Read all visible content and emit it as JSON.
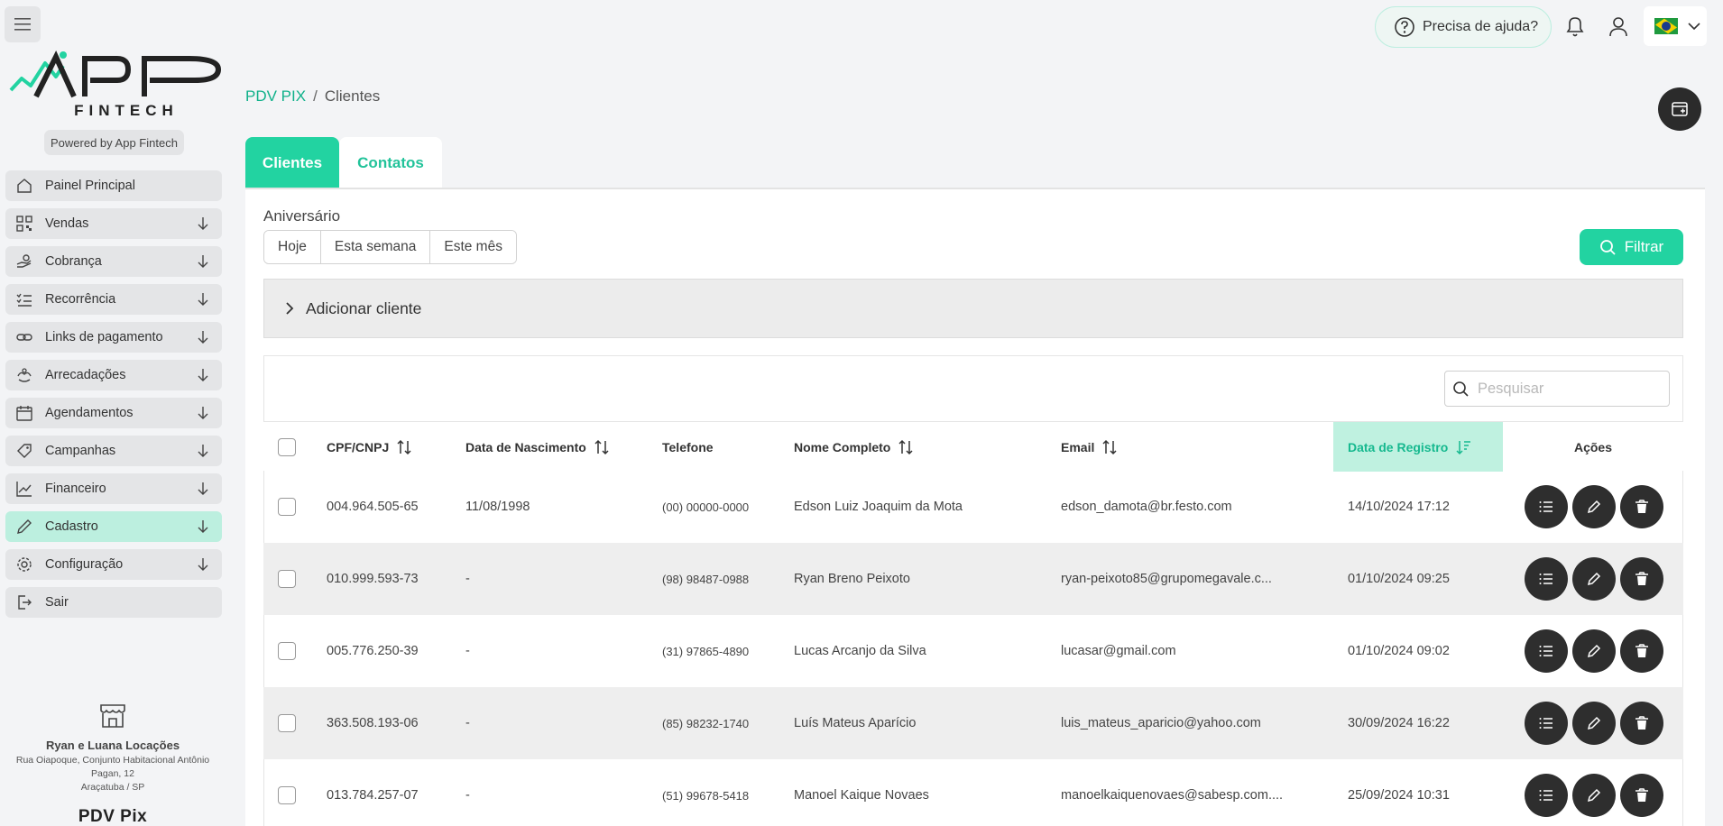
{
  "sidebar": {
    "logo_text": "APP",
    "logo_sub": "FINTECH",
    "powered_by": "Powered by App Fintech",
    "items": [
      {
        "label": "Painel Principal",
        "icon": "home-icon"
      },
      {
        "label": "Vendas",
        "icon": "qrcode-icon"
      },
      {
        "label": "Cobrança",
        "icon": "hand-coin-icon"
      },
      {
        "label": "Recorrência",
        "icon": "list-check-icon"
      },
      {
        "label": "Links de pagamento",
        "icon": "link-icon"
      },
      {
        "label": "Arrecadações",
        "icon": "hands-icon"
      },
      {
        "label": "Agendamentos",
        "icon": "calendar-icon"
      },
      {
        "label": "Campanhas",
        "icon": "tag-icon"
      },
      {
        "label": "Financeiro",
        "icon": "chart-line-icon"
      },
      {
        "label": "Cadastro",
        "icon": "pencil-icon"
      },
      {
        "label": "Configuração",
        "icon": "gear-icon"
      },
      {
        "label": "Sair",
        "icon": "logout-icon"
      }
    ],
    "store": {
      "name": "Ryan e Luana Locações",
      "address_line1": "Rua Oiapoque, Conjunto Habitacional Antônio",
      "address_line2": "Pagan, 12",
      "address_line3": "Araçatuba / SP"
    },
    "footer_title": "PDV Pix"
  },
  "header": {
    "help_label": "Precisa de ajuda?"
  },
  "breadcrumb": {
    "root": "PDV PIX",
    "separator": "/",
    "current": "Clientes"
  },
  "tabs": [
    {
      "label": "Clientes",
      "active": true
    },
    {
      "label": "Contatos",
      "active": false
    }
  ],
  "birthday": {
    "label": "Aniversário",
    "options": [
      "Hoje",
      "Esta semana",
      "Este mês"
    ]
  },
  "filter_label": "Filtrar",
  "add_client_label": "Adicionar cliente",
  "search": {
    "placeholder": "Pesquisar"
  },
  "table": {
    "columns": [
      "CPF/CNPJ",
      "Data de Nascimento",
      "Telefone",
      "Nome Completo",
      "Email",
      "Data de Registro",
      "Ações"
    ],
    "rows": [
      {
        "cpf": "004.964.505-65",
        "nasc": "11/08/1998",
        "tel": "(00) 00000-0000",
        "nome": "Edson Luiz Joaquim da Mota",
        "email": "edson_damota@br.festo.com",
        "registro": "14/10/2024 17:12"
      },
      {
        "cpf": "010.999.593-73",
        "nasc": "-",
        "tel": "(98) 98487-0988",
        "nome": "Ryan Breno Peixoto",
        "email": "ryan-peixoto85@grupomegavale.c...",
        "registro": "01/10/2024 09:25"
      },
      {
        "cpf": "005.776.250-39",
        "nasc": "-",
        "tel": "(31) 97865-4890",
        "nome": "Lucas Arcanjo da Silva",
        "email": "lucasar@gmail.com",
        "registro": "01/10/2024 09:02"
      },
      {
        "cpf": "363.508.193-06",
        "nasc": "-",
        "tel": "(85) 98232-1740",
        "nome": "Luís Mateus Aparício",
        "email": "luis_mateus_aparicio@yahoo.com",
        "registro": "30/09/2024 16:22"
      },
      {
        "cpf": "013.784.257-07",
        "nasc": "-",
        "tel": "(51) 99678-5418",
        "nome": "Manoel Kaique Novaes",
        "email": "manoelkaiquenovaes@sabesp.com....",
        "registro": "25/09/2024 10:31"
      }
    ]
  },
  "colors": {
    "accent": "#22d3a1",
    "accent_text": "#10b18a",
    "highlight_bg": "#bff1e0",
    "dark_button": "#2e2e2e"
  }
}
